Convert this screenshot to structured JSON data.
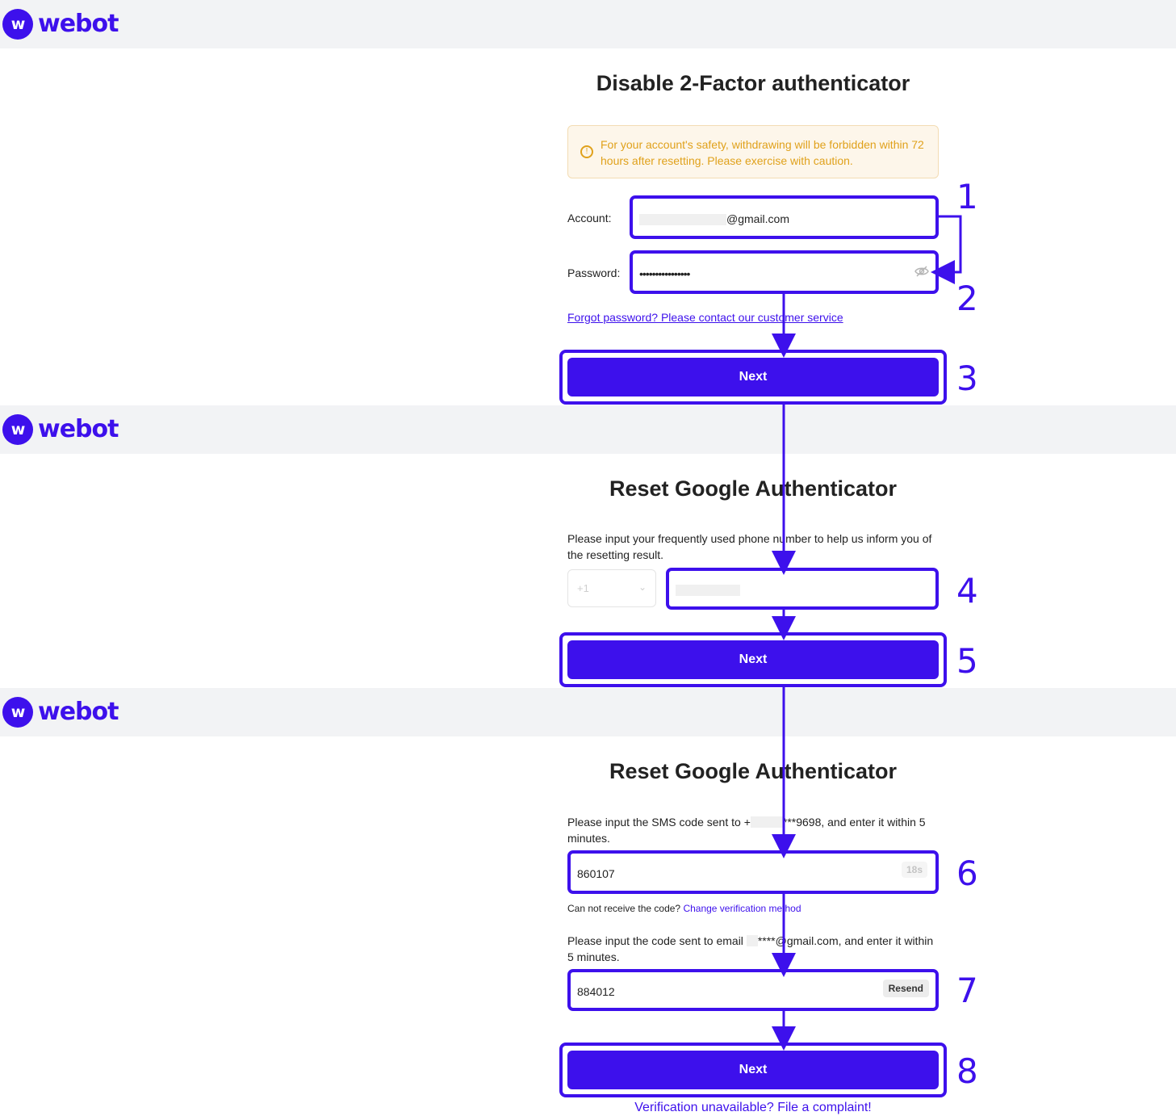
{
  "brand": {
    "logo_mark": "w",
    "name": "webot",
    "color": "#3d10ec"
  },
  "page1": {
    "title": "Disable 2-Factor authenticator",
    "notice_icon": "lightbulb-icon",
    "notice": "For your account's safety, withdrawing will be forbidden within 72 hours after resetting. Please exercise with caution.",
    "account_label": "Account:",
    "account_value": "@gmail.com",
    "password_label": "Password:",
    "password_value": "••••••••••••••••",
    "password_toggle_icon": "eye-slash-icon",
    "forgot_link": "Forgot password? Please contact our customer service",
    "next_label": "Next"
  },
  "page2": {
    "title": "Reset Google Authenticator",
    "instruction": "Please input your frequently used phone number to help us inform you of the resetting result.",
    "country_code": "+1",
    "next_label": "Next"
  },
  "page3": {
    "title": "Reset Google Authenticator",
    "sms_instruction_prefix": "Please input the SMS code sent to +",
    "sms_instruction_suffix": "***9698, and enter it within 5 minutes.",
    "sms_code": "860107",
    "sms_timer": "18s",
    "helper_text": "Can not receive the code?",
    "helper_link": "Change verification method",
    "email_instruction_prefix": "Please input the code sent to email",
    "email_instruction_suffix": "****@gmail.com, and enter it within 5 minutes.",
    "email_code": "884012",
    "resend_label": "Resend",
    "next_label": "Next",
    "complaint_link": "Verification unavailable? File a complaint!"
  },
  "steps": [
    "1",
    "2",
    "3",
    "4",
    "5",
    "6",
    "7",
    "8"
  ]
}
